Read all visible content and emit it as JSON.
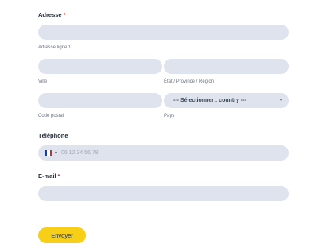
{
  "address": {
    "label": "Adresse",
    "required_mark": "*",
    "line1_caption": "Adresse ligne 1",
    "city_caption": "Ville",
    "state_caption": "État / Province / Région",
    "postal_caption": "Code postal",
    "country_caption": "Pays",
    "country_select_value": "--- Sélectionner : country ---"
  },
  "phone": {
    "label": "Téléphone",
    "placeholder": "06 12 34 56 78",
    "flag_colors": [
      "#1c3f94",
      "#ffffff",
      "#e1251b"
    ]
  },
  "email": {
    "label": "E-mail",
    "required_mark": "*"
  },
  "submit": {
    "label": "Envoyer",
    "color": "#f6cf16"
  }
}
